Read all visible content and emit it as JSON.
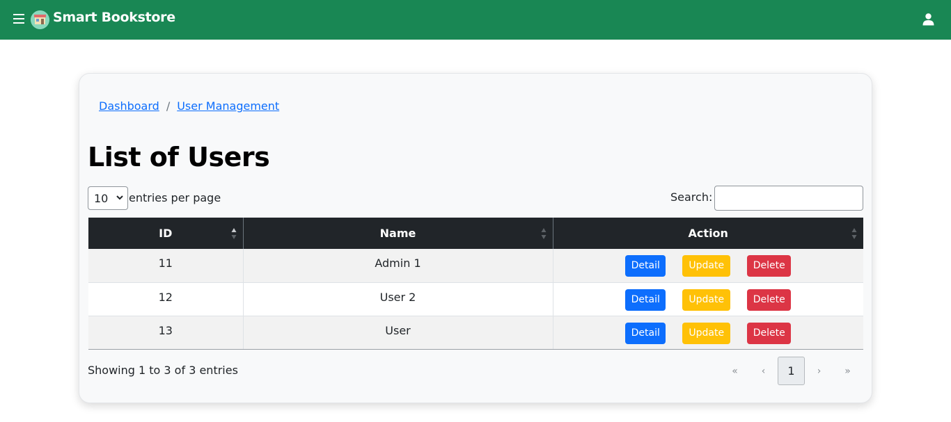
{
  "navbar": {
    "brand": "Smart Bookstore",
    "bg_color": "#198754",
    "menu_icon": "hamburger-icon",
    "user_icon": "user-icon"
  },
  "breadcrumb": {
    "items": [
      "Dashboard",
      "User Management"
    ],
    "separator": "/"
  },
  "page_title": "List of Users",
  "controls": {
    "entries_value": "10",
    "entries_label": "entries per page",
    "search_label": "Search:",
    "search_value": ""
  },
  "table": {
    "columns": [
      "ID",
      "Name",
      "Action"
    ],
    "rows": [
      {
        "id": "11",
        "name": "Admin 1"
      },
      {
        "id": "12",
        "name": "User 2"
      },
      {
        "id": "13",
        "name": "User"
      }
    ],
    "actions": {
      "detail": "Detail",
      "update": "Update",
      "delete": "Delete"
    }
  },
  "footer": {
    "showing": "Showing 1 to 3 of 3 entries",
    "pager": {
      "first": "«",
      "prev": "‹",
      "current": "1",
      "next": "›",
      "last": "»"
    }
  },
  "colors": {
    "primary": "#0d6efd",
    "warning": "#ffc107",
    "danger": "#dc3545",
    "header_dark": "#212529"
  }
}
